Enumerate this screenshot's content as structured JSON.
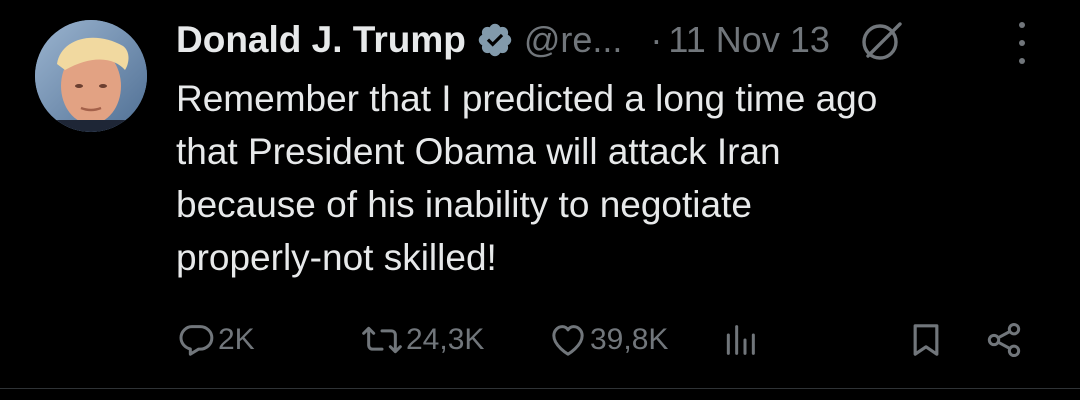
{
  "tweet": {
    "author_name": "Donald J. Trump",
    "handle": "@re...",
    "separator": "·",
    "date": "11 Nov 13",
    "body_lines": [
      "Remember that I predicted a long time ago",
      "that President Obama will attack Iran",
      "because of his inability to negotiate",
      "properly-not skilled!"
    ]
  },
  "actions": {
    "reply_count": "2K",
    "retweet_count": "24,3K",
    "like_count": "39,8K"
  },
  "icons": {
    "verified": "verified-badge-icon",
    "grok": "grok-icon",
    "more": "more-options-icon",
    "reply": "reply-icon",
    "retweet": "retweet-icon",
    "like": "like-icon",
    "views": "views-icon",
    "bookmark": "bookmark-icon",
    "share": "share-icon"
  },
  "colors": {
    "background": "#000000",
    "text_primary": "#e7e9ea",
    "text_secondary": "#71767b",
    "verified_badge": "#829aab"
  }
}
